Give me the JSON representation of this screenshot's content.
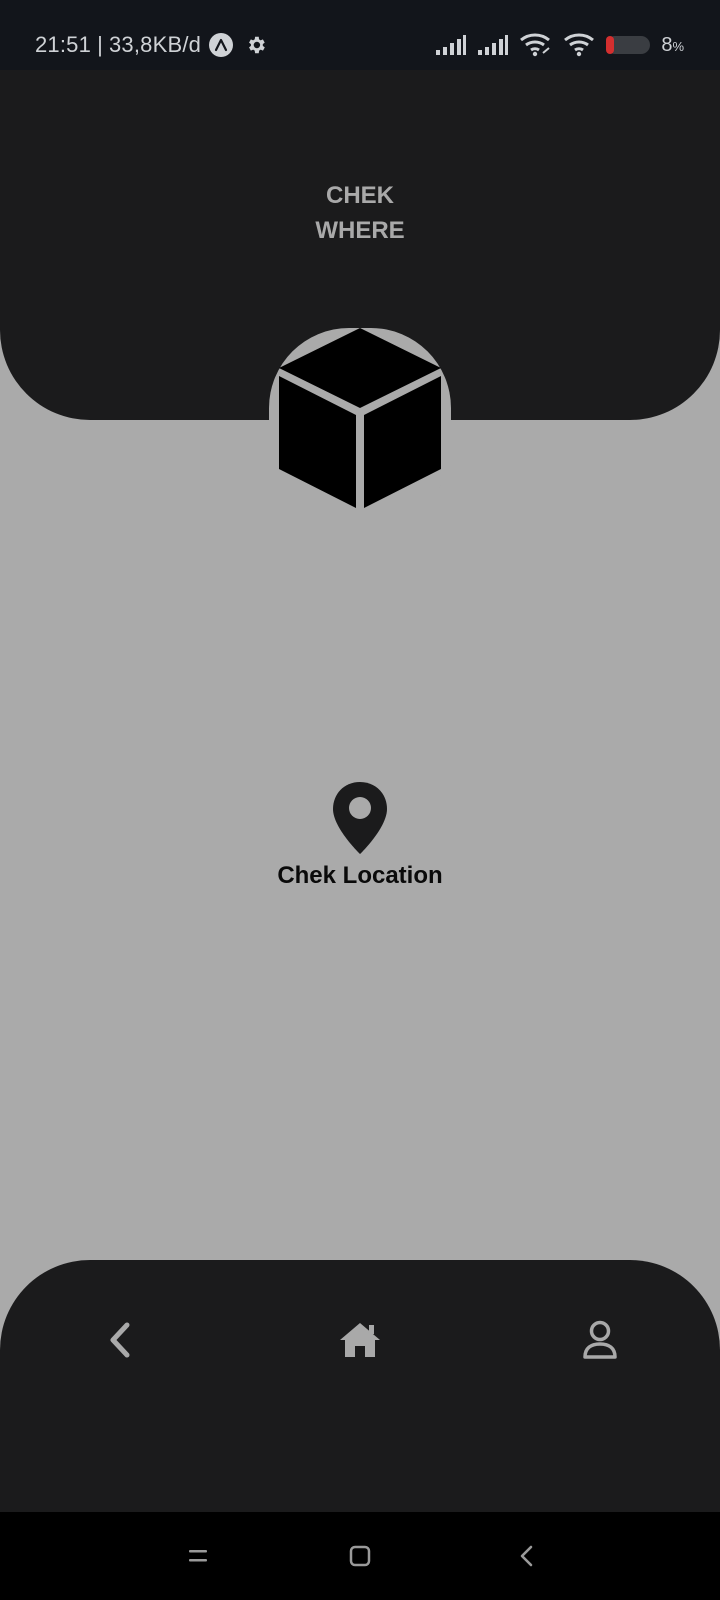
{
  "status_bar": {
    "time": "21:51",
    "separator": "|",
    "network_speed": "33,8KB/d",
    "battery_percent": "8",
    "battery_unit": "%",
    "icons": [
      "app-a-icon",
      "gear-icon",
      "signal-icon",
      "signal-icon",
      "wifi-link-icon",
      "wifi-icon",
      "battery-icon"
    ],
    "battery_level_fraction": 0.08
  },
  "header": {
    "title_line1": "CHEK",
    "title_line2": "WHERE",
    "logo_icon": "cube-icon"
  },
  "main": {
    "location_icon": "map-pin-icon",
    "location_label": "Chek Location"
  },
  "bottom_nav": {
    "items": [
      {
        "icon": "chevron-left-icon"
      },
      {
        "icon": "home-icon"
      },
      {
        "icon": "user-icon"
      }
    ]
  },
  "system_nav": {
    "items": [
      {
        "icon": "recents-icon"
      },
      {
        "icon": "home-square-icon"
      },
      {
        "icon": "back-chevron-icon"
      }
    ]
  },
  "colors": {
    "background": "#aaaaaa",
    "surface": "#1b1b1c",
    "status_bar": "#12151b",
    "title_text": "#a9a9a9",
    "battery_low": "#d32f2f"
  }
}
